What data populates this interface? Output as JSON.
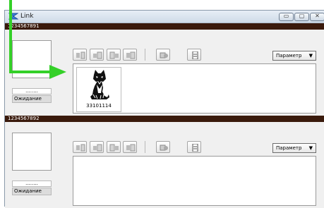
{
  "window": {
    "title": "Link",
    "min_glyph": "▭",
    "max_glyph": "▢",
    "close_glyph": "✕"
  },
  "panels": [
    {
      "id": "1234567891",
      "dots": "........",
      "status": "Ожидание",
      "dropdown": {
        "selected": "Параметр"
      },
      "items": [
        {
          "label": "33101114",
          "icon": "husky-image"
        }
      ]
    },
    {
      "id": "1234567892",
      "dots": "........",
      "status": "Ожидание",
      "dropdown": {
        "selected": "Параметр"
      },
      "items": []
    }
  ],
  "annotation": {
    "color": "#34d028",
    "shape": "arrow-to-thumbnail"
  }
}
